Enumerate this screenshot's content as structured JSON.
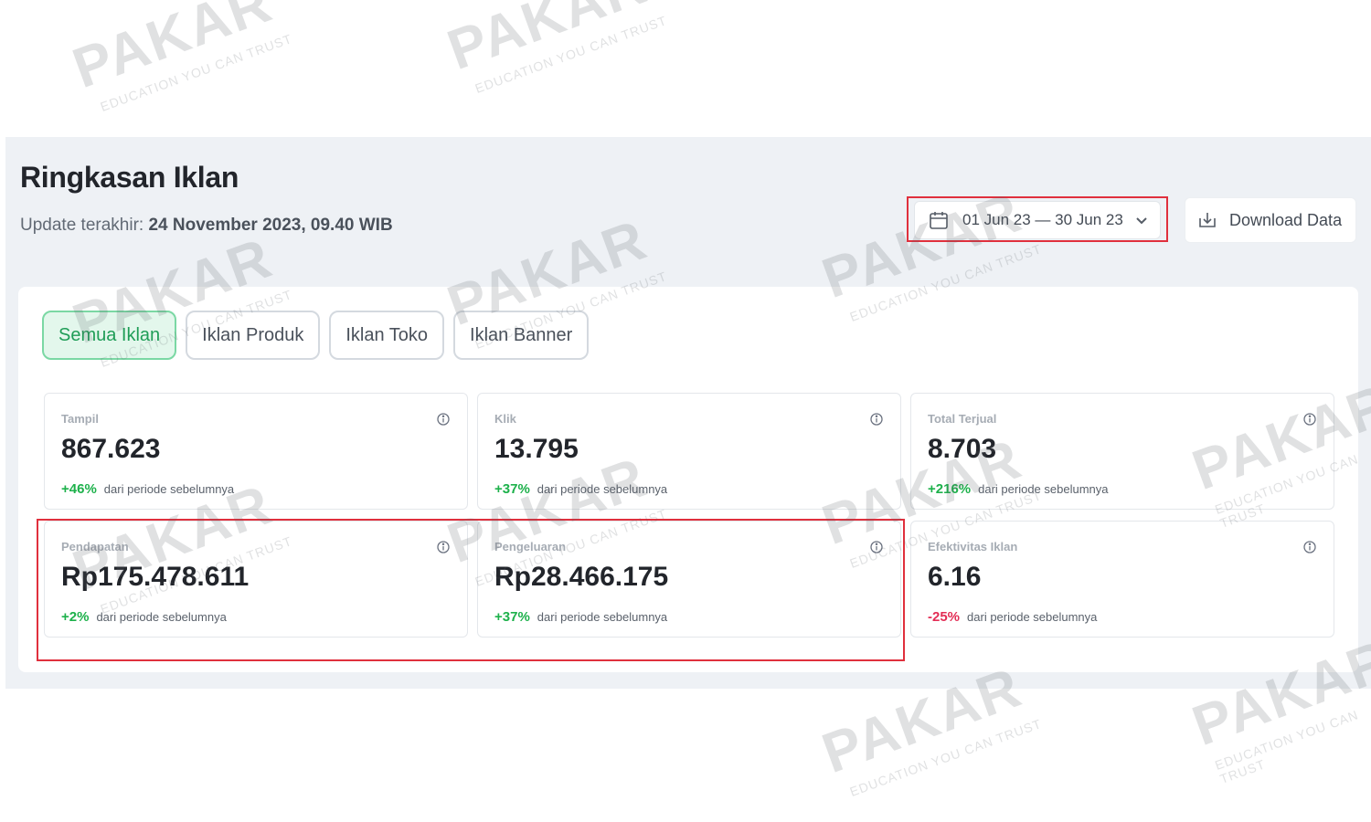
{
  "header": {
    "title": "Ringkasan Iklan",
    "update_label": "Update terakhir:",
    "update_value": "24 November 2023, 09.40 WIB"
  },
  "toolbar": {
    "date_range": "01 Jun 23 — 30 Jun 23",
    "download_label": "Download Data"
  },
  "tabs": [
    {
      "label": "Semua Iklan",
      "active": true
    },
    {
      "label": "Iklan Produk",
      "active": false
    },
    {
      "label": "Iklan Toko",
      "active": false
    },
    {
      "label": "Iklan Banner",
      "active": false
    }
  ],
  "metrics": [
    {
      "label": "Tampil",
      "value": "867.623",
      "change": "+46%",
      "direction": "up",
      "desc": "dari periode sebelumnya"
    },
    {
      "label": "Klik",
      "value": "13.795",
      "change": "+37%",
      "direction": "up",
      "desc": "dari periode sebelumnya"
    },
    {
      "label": "Total Terjual",
      "value": "8.703",
      "change": "+216%",
      "direction": "up",
      "desc": "dari periode sebelumnya"
    },
    {
      "label": "Pendapatan",
      "value": "Rp175.478.611",
      "change": "+2%",
      "direction": "up",
      "desc": "dari periode sebelumnya"
    },
    {
      "label": "Pengeluaran",
      "value": "Rp28.466.175",
      "change": "+37%",
      "direction": "up",
      "desc": "dari periode sebelumnya"
    },
    {
      "label": "Efektivitas Iklan",
      "value": "6.16",
      "change": "-25%",
      "direction": "down",
      "desc": "dari periode sebelumnya"
    }
  ],
  "watermark": {
    "brand": "PAKAR",
    "tagline": "EDUCATION YOU CAN TRUST"
  },
  "colors": {
    "accent_green": "#1f9d57",
    "positive": "#1db14b",
    "negative": "#e32d55",
    "highlight_red": "#e0303d"
  }
}
